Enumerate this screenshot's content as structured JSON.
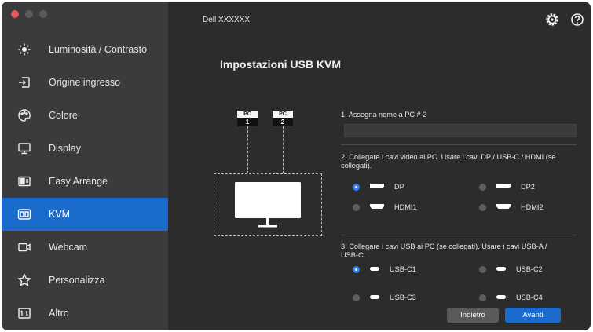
{
  "window": {
    "title": "Dell XXXXXX"
  },
  "sidebar": {
    "items": [
      {
        "label": "Luminosità / Contrasto",
        "icon": "brightness-icon"
      },
      {
        "label": "Origine ingresso",
        "icon": "input-source-icon"
      },
      {
        "label": "Colore",
        "icon": "color-palette-icon"
      },
      {
        "label": "Display",
        "icon": "monitor-icon"
      },
      {
        "label": "Easy Arrange",
        "icon": "layout-icon"
      },
      {
        "label": "KVM",
        "icon": "kvm-icon",
        "active": true
      },
      {
        "label": "Webcam",
        "icon": "webcam-icon"
      },
      {
        "label": "Personalizza",
        "icon": "star-icon"
      },
      {
        "label": "Altro",
        "icon": "other-icon"
      }
    ]
  },
  "header": {
    "icons": [
      "settings-gear-icon",
      "help-icon"
    ]
  },
  "page": {
    "title": "Impostazioni USB KVM"
  },
  "diagram": {
    "pc1": {
      "top": "PC",
      "bottom": "1"
    },
    "pc2": {
      "top": "PC",
      "bottom": "2"
    }
  },
  "step1": {
    "label": "1. Assegna nome a PC # 2",
    "value": "",
    "placeholder": ""
  },
  "step2": {
    "label": "2. Collegare i cavi video ai PC. Usare i cavi DP / USB-C / HDMI (se collegati).",
    "options": [
      {
        "label": "DP",
        "selected": true
      },
      {
        "label": "DP2",
        "selected": false
      },
      {
        "label": "HDMI1",
        "selected": false
      },
      {
        "label": "HDMI2",
        "selected": false
      }
    ]
  },
  "step3": {
    "label": "3. Collegare i cavi USB ai PC (se collegati). Usare i cavi USB-A / USB-C.",
    "options": [
      {
        "label": "USB-C1",
        "selected": true
      },
      {
        "label": "USB-C2",
        "selected": false
      },
      {
        "label": "USB-C3",
        "selected": false
      },
      {
        "label": "USB-C4",
        "selected": false
      }
    ]
  },
  "buttons": {
    "back": "Indietro",
    "next": "Avanti"
  },
  "colors": {
    "accent": "#1a6bcb",
    "sidebar": "#3b3b3d",
    "background": "#2c2c2d",
    "radio_on": "#2d7ff9"
  }
}
